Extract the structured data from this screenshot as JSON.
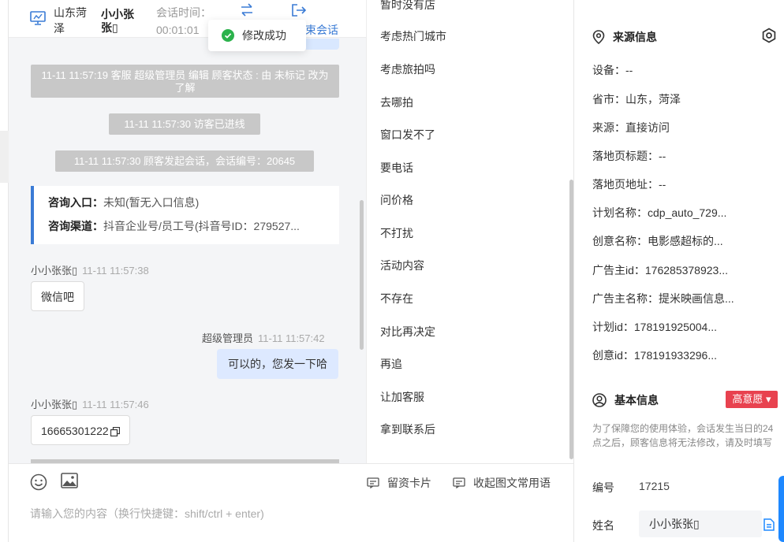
{
  "header": {
    "location": "山东菏泽",
    "customer_name": "小小张张▯",
    "time_label": "会话时间：",
    "time_value": "00:01:01",
    "end_label": "束会话"
  },
  "toast": {
    "text": "修改成功"
  },
  "chat": {
    "system_messages": [
      "11-11 11:57:19 客服 超级管理员 编辑 顾客状态 : 由 未标记 改为 了解",
      "11-11 11:57:30 访客已进线",
      "11-11 11:57:30 顾客发起会话，会话编号：20645"
    ],
    "consult": {
      "entry_label": "咨询入口：",
      "entry_value": "未知(暂无入口信息)",
      "channel_label": "咨询渠道：",
      "channel_value": "抖音企业号/员工号(抖音号ID：279527..."
    },
    "messages": [
      {
        "sender": "小小张张▯",
        "time": "11-11 11:57:38",
        "text": "微信吧"
      },
      {
        "sender": "超级管理员",
        "time": "11-11 11:57:42",
        "text": "可以的，您发一下哈"
      },
      {
        "sender": "小小张张▯",
        "time": "11-11 11:57:46",
        "text": "16665301222"
      }
    ]
  },
  "input": {
    "placeholder": "请输入您的内容（换行快捷键：shift/ctrl + enter)",
    "tool_lead_card": "留资卡片",
    "tool_collapse": "收起图文常用语"
  },
  "phrases": [
    "暂时没有店",
    "考虑热门城市",
    "考虑旅拍吗",
    "去哪拍",
    "窗口发不了",
    "要电话",
    "问价格",
    "不打扰",
    "活动内容",
    "不存在",
    "对比再决定",
    "再追",
    "让加客服",
    "拿到联系后"
  ],
  "info": {
    "source_title": "来源信息",
    "source_rows": [
      "设备：--",
      "省市：山东，菏泽",
      "来源：直接访问",
      "落地页标题：--",
      "落地页地址：--",
      "计划名称：cdp_auto_729...",
      "创意名称：电影感超标的...",
      "广告主id：176285378923...",
      "广告主名称：提米映画信息...",
      "计划id：178191925004...",
      "创意id：178191933296..."
    ],
    "basic_title": "基本信息",
    "intent_badge": "高意愿 ▾",
    "notice": "为了保障您的使用体验，会话发生当日的24点之后，顾客信息将无法修改，请及时填写",
    "id_label": "编号",
    "id_value": "17215",
    "name_label": "姓名",
    "name_value": "小小张张▯"
  },
  "colors": {
    "accent": "#3a7bd5",
    "badge": "#e8424f",
    "toast_success": "#2bb24c"
  }
}
